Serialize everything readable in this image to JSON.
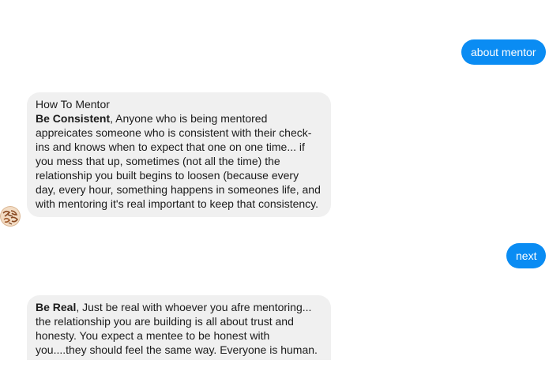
{
  "chat": {
    "messages": [
      {
        "side": "outgoing",
        "text": "about mentor"
      },
      {
        "side": "incoming",
        "title": "How To Mentor",
        "bold": "Be Consistent",
        "body": ", Anyone who is being mentored appreicates someone who is consistent with their check-ins and knows when to expect that one on one time... if you mess that up, sometimes (not all the time) the relationship you built begins to loosen (because every day, every hour, something happens in someones life, and with mentoring it's real important to keep that consistency."
      },
      {
        "side": "outgoing",
        "text": "next"
      },
      {
        "side": "incoming",
        "bold": "Be Real",
        "body": ", Just be real with whoever you afre mentoring... the relationship you are building is all about trust and honesty. You expect a mentee to be honest with you....they should feel the same way. Everyone is human. Don't try to be a super hero. Yes, they may see you as"
      }
    ]
  },
  "avatar": {
    "icon": "bot-avatar-icon"
  },
  "colors": {
    "outgoing_bubble": "#0a8cf3",
    "incoming_bubble": "#f0f0f0",
    "text": "#1b1b1b"
  }
}
